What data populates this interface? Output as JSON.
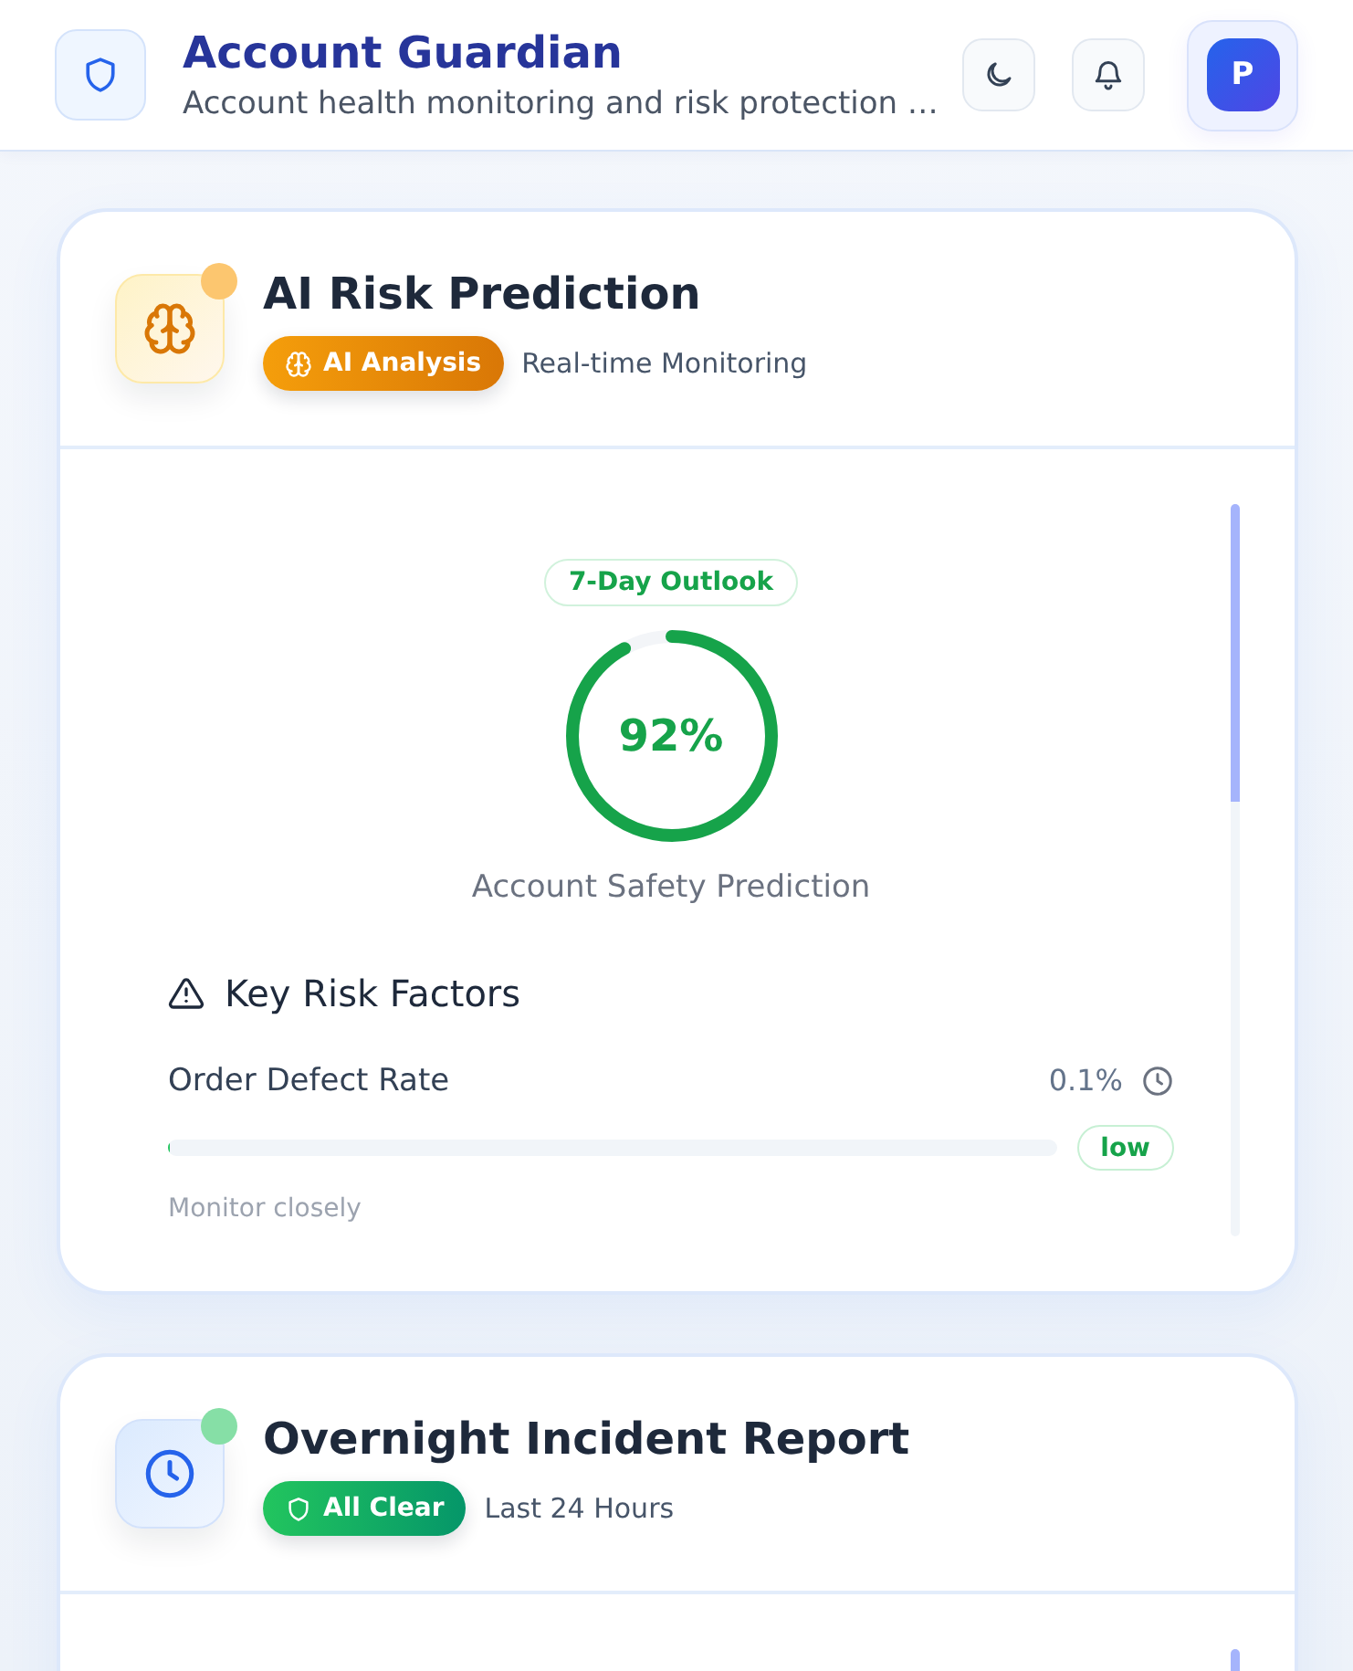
{
  "header": {
    "title": "Account Guardian",
    "subtitle": "Account health monitoring and risk protection …",
    "avatar": "P"
  },
  "cards": [
    {
      "kind": "prediction",
      "title": "AI Risk Prediction",
      "color": "#fcc66f",
      "badge": "AI Analysis",
      "caption": "Real-time Monitoring",
      "outlook": {
        "label": "7-Day Outlook",
        "value": "92%",
        "level": 0.92,
        "caption": "Account Safety Prediction"
      },
      "risk_factors": {
        "title": "Key Risk Factors",
        "items": [
          {
            "name": "Order Defect Rate",
            "value": "0.1%",
            "level": 0.001,
            "rating": "low",
            "note": "Monitor closely"
          }
        ]
      }
    },
    {
      "kind": "incident",
      "title": "Overnight Incident Report",
      "color": "#86dfa6",
      "badge": "All Clear",
      "caption": "Last 24 Hours"
    }
  ]
}
